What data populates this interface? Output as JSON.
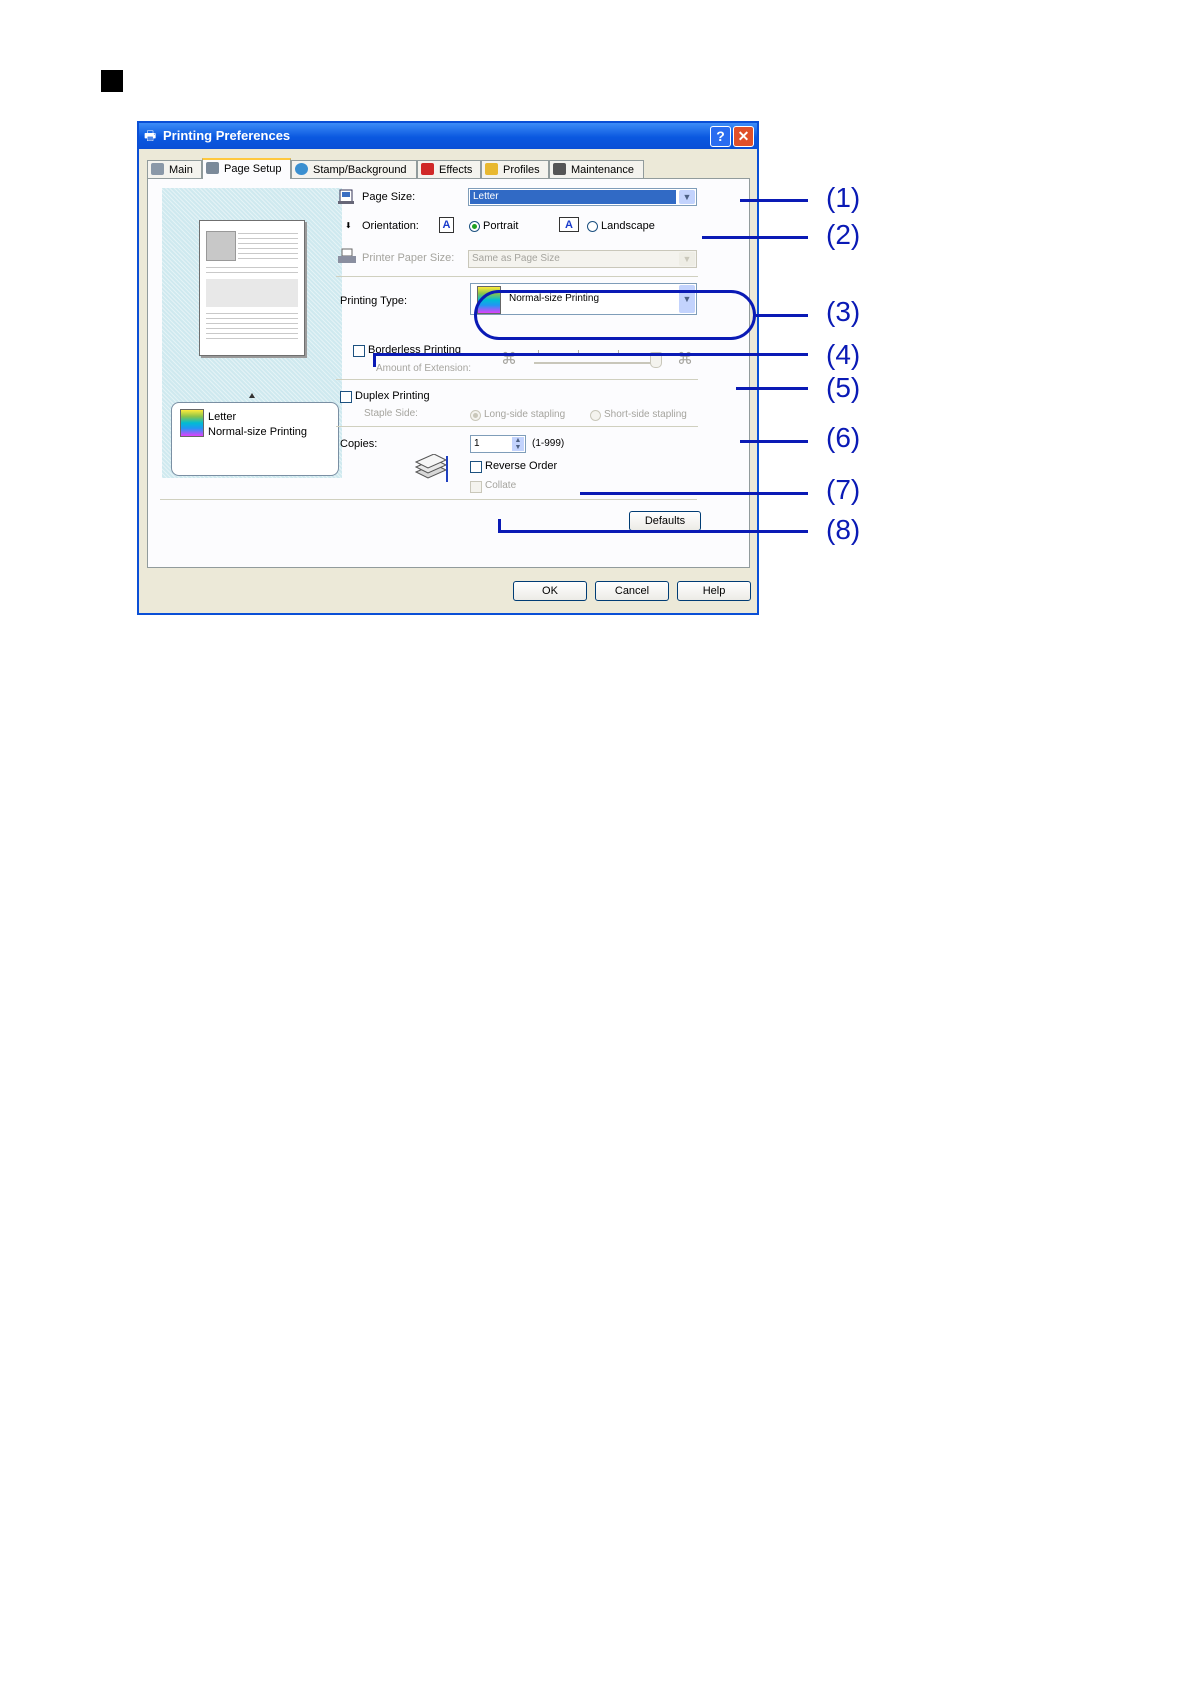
{
  "dialog": {
    "title": "Printing Preferences",
    "help_glyph": "?",
    "close_glyph": "✕"
  },
  "tabs": [
    {
      "label": "Main",
      "icon": "printer-icon"
    },
    {
      "label": "Page Setup",
      "icon": "page-setup-icon"
    },
    {
      "label": "Stamp/Background",
      "icon": "stamp-icon"
    },
    {
      "label": "Effects",
      "icon": "effects-icon"
    },
    {
      "label": "Profiles",
      "icon": "profiles-icon"
    },
    {
      "label": "Maintenance",
      "icon": "maintenance-icon"
    }
  ],
  "preview": {
    "line1": "Letter",
    "line2": "Normal-size Printing"
  },
  "page_size": {
    "label": "Page Size:",
    "value": "Letter"
  },
  "orientation": {
    "label": "Orientation:",
    "portrait": "Portrait",
    "landscape": "Landscape",
    "selected": "Portrait",
    "glyph": "A"
  },
  "printer_paper_size": {
    "label": "Printer Paper Size:",
    "value": "Same as Page Size"
  },
  "printing_type": {
    "label": "Printing Type:",
    "value": "Normal-size Printing"
  },
  "borderless": {
    "label": "Borderless Printing",
    "checked": false,
    "extension_label": "Amount of Extension:"
  },
  "duplex": {
    "label": "Duplex Printing",
    "checked": false,
    "staple_label": "Staple Side:",
    "long_side": "Long-side stapling",
    "short_side": "Short-side stapling",
    "selected": "Long-side stapling"
  },
  "copies": {
    "label": "Copies:",
    "value": "1",
    "range": "(1-999)"
  },
  "reverse_order": {
    "label": "Reverse Order",
    "checked": false
  },
  "collate": {
    "label": "Collate",
    "checked": false
  },
  "buttons": {
    "defaults": "Defaults",
    "ok": "OK",
    "cancel": "Cancel",
    "help": "Help"
  },
  "annotations": [
    "(1)",
    "(2)",
    "(3)",
    "(4)",
    "(5)",
    "(6)",
    "(7)",
    "(8)"
  ],
  "colors": {
    "annotation": "#0a1ab5",
    "titlebar": "#0a4fd6",
    "selection": "#316ac5"
  }
}
